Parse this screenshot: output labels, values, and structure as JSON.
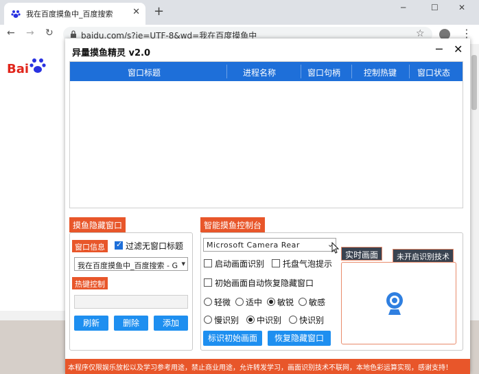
{
  "browser": {
    "tab_title": "我在百度摸鱼中_百度搜索",
    "tab_close": "✕",
    "new_tab": "+",
    "url": "baidu.com/s?ie=UTF-8&wd=我在百度摸鱼中",
    "controls": {
      "minimize": "─",
      "maximize": "☐",
      "close": "✕"
    },
    "nav": {
      "back": "←",
      "forward": "→",
      "reload": "↻"
    },
    "baidu_logo": "Bai 百度",
    "lock_icon": "lock-icon",
    "star_icon": "star-icon"
  },
  "app": {
    "title": "异量摸鱼精灵 v2.0",
    "minimize": "─",
    "close": "✕",
    "table": {
      "columns": [
        "窗口标题",
        "进程名称",
        "窗口句柄",
        "控制热键",
        "窗口状态"
      ],
      "rows": []
    },
    "hide_section": {
      "tag": "摸鱼隐藏窗口",
      "window_info_tag": "窗口信息",
      "filter_checkbox": {
        "label": "过滤无窗口标题",
        "checked": true
      },
      "window_select": "我在百度摸鱼中_百度搜索 - Go",
      "hotkey_tag": "热键控制",
      "hotkey_value": "",
      "buttons": [
        "刷新",
        "删除",
        "添加"
      ]
    },
    "control_section": {
      "tag": "智能摸鱼控制台",
      "camera_select": "Microsoft Camera Rear",
      "check_start_recognition": {
        "label": "启动画面识别",
        "checked": false
      },
      "check_tray_tip": {
        "label": "托盘气泡提示",
        "checked": false
      },
      "check_auto_restore": {
        "label": "初始画面自动恢复隐藏窗口",
        "checked": false
      },
      "sensitivity": {
        "options": [
          "轻微",
          "适中",
          "敏锐",
          "敏感"
        ],
        "selected": "敏锐"
      },
      "speed": {
        "options": [
          "慢识别",
          "中识别",
          "快识别"
        ],
        "selected": "中识别"
      },
      "buttons": [
        "标识初始画面",
        "恢复隐藏窗口"
      ],
      "preview_tag": "实时画面",
      "status_tag": "未开启识别技术",
      "preview_icon": "webcam-icon"
    },
    "footer": "本程序仅限娱乐放松以及学习参考用途，禁止商业用途，允许转发学习，画面识别技术不联网，本地色彩运算实现，感谢支持！",
    "colors": {
      "accent_blue": "#1e6fd9",
      "button_blue": "#1e8ff0",
      "tag_orange": "#e8562a",
      "dark_tag": "#3a4350"
    }
  }
}
